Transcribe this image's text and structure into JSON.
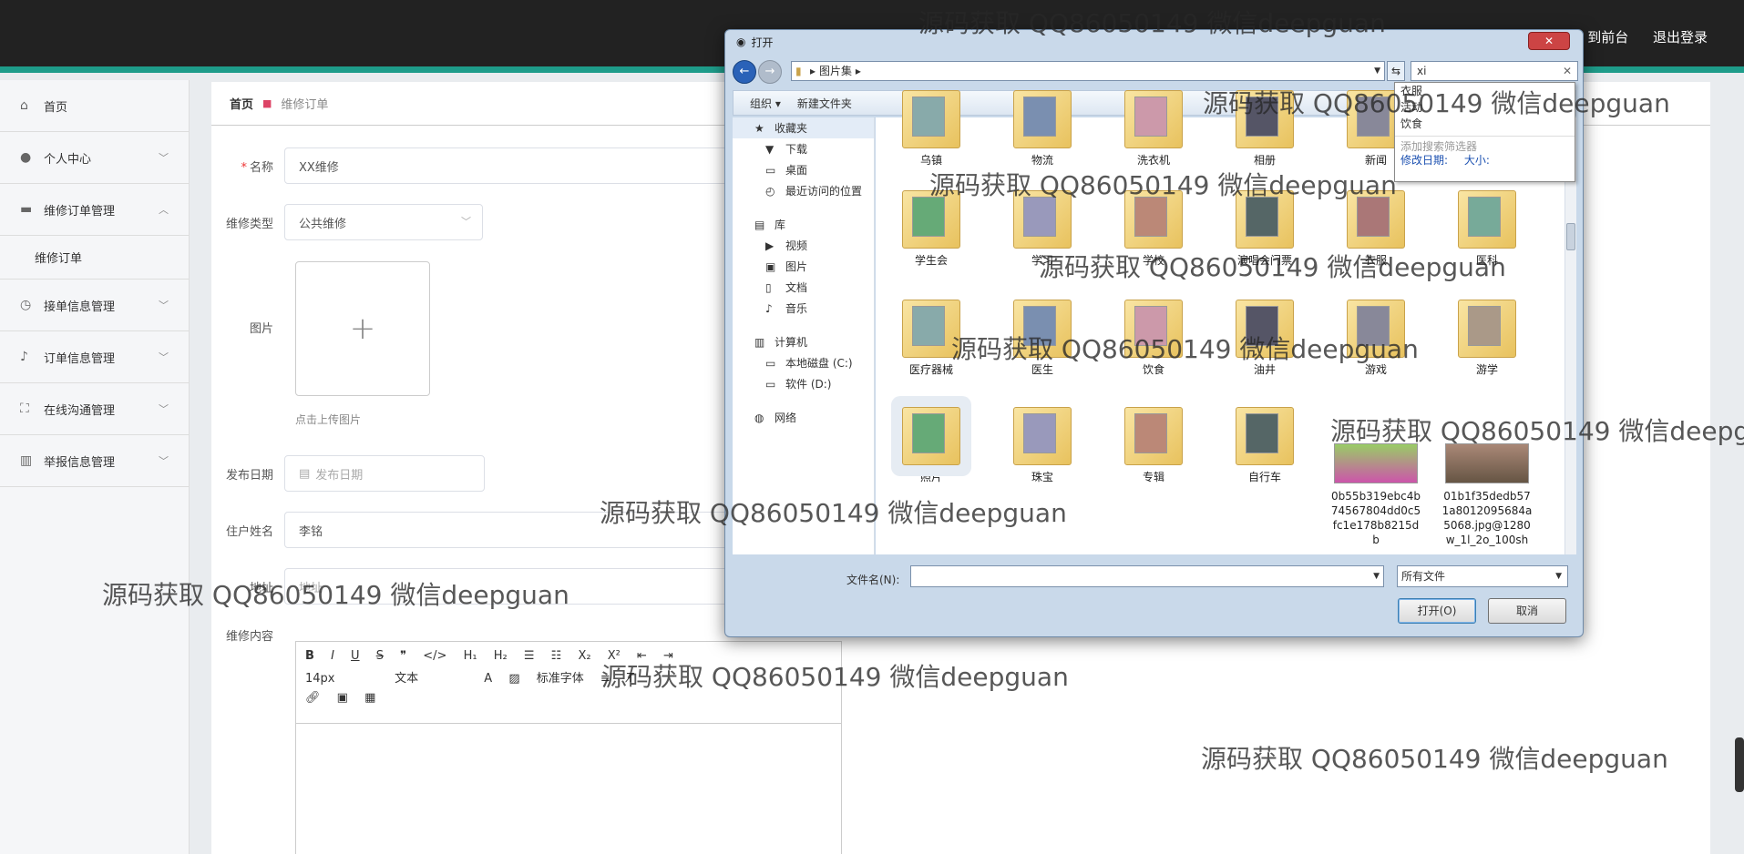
{
  "topbar": {
    "link_front": "到前台",
    "link_logout": "退出登录"
  },
  "sidebar": {
    "items": [
      {
        "label": "首页",
        "icon": "home-icon"
      },
      {
        "label": "个人中心",
        "icon": "user-icon"
      },
      {
        "label": "维修订单管理",
        "icon": "briefcase-icon"
      },
      {
        "label": "维修订单",
        "icon": ""
      },
      {
        "label": "接单信息管理",
        "icon": "clock-icon"
      },
      {
        "label": "订单信息管理",
        "icon": "mic-icon"
      },
      {
        "label": "在线沟通管理",
        "icon": "frame-icon"
      },
      {
        "label": "举报信息管理",
        "icon": "bars-icon"
      }
    ]
  },
  "breadcrumb": {
    "home": "首页",
    "current": "维修订单"
  },
  "form": {
    "name_label": "名称",
    "name_value": "XX维修",
    "type_label": "维修类型",
    "type_value": "公共维修",
    "image_label": "图片",
    "upload_hint": "点击上传图片",
    "date_label": "发布日期",
    "date_placeholder": "发布日期",
    "resident_label": "住户姓名",
    "resident_value": "李铭",
    "address_label": "地址",
    "address_value": "地址",
    "content_label": "维修内容",
    "editor_font_size": "14px",
    "editor_text": "文本",
    "editor_heading": "标准字体"
  },
  "dialog": {
    "title": "打开",
    "close": "✕",
    "path": "图片集",
    "search_value": "xi",
    "toolbar_organize": "组织 ▾",
    "toolbar_newfolder": "新建文件夹",
    "tree": [
      {
        "label": "收藏夹",
        "icon": "star-icon",
        "sub": false,
        "hl": true
      },
      {
        "label": "下载",
        "icon": "download-icon",
        "sub": true
      },
      {
        "label": "桌面",
        "icon": "desktop-icon",
        "sub": true
      },
      {
        "label": "最近访问的位置",
        "icon": "recent-icon",
        "sub": true
      },
      {
        "label": "库",
        "icon": "library-icon",
        "sub": false,
        "gap": true
      },
      {
        "label": "视频",
        "icon": "video-icon",
        "sub": true
      },
      {
        "label": "图片",
        "icon": "picture-icon",
        "sub": true
      },
      {
        "label": "文档",
        "icon": "document-icon",
        "sub": true
      },
      {
        "label": "音乐",
        "icon": "music-icon",
        "sub": true
      },
      {
        "label": "计算机",
        "icon": "computer-icon",
        "sub": false,
        "gap": true
      },
      {
        "label": "本地磁盘 (C:)",
        "icon": "disk-icon",
        "sub": true
      },
      {
        "label": "软件 (D:)",
        "icon": "disk-icon",
        "sub": true
      },
      {
        "label": "网络",
        "icon": "network-icon",
        "sub": false,
        "gap": true
      }
    ],
    "files": [
      "乌镇",
      "物流",
      "洗衣机",
      "相册",
      "新闻",
      "",
      "学生会",
      "学习",
      "学校",
      "演唱会门票",
      "衣服",
      "医科",
      "医疗器械",
      "医生",
      "饮食",
      "油井",
      "游戏",
      "游学",
      "照片",
      "珠宝",
      "专辑",
      "自行车",
      "0b55b319ebc4b74567804dd0c5fc1e178b8215db",
      "01b1f35dedb571a8012095684a5068.jpg@1280w_1l_2o_100sh"
    ],
    "filename_label": "文件名(N):",
    "filename_value": "",
    "filetype_value": "所有文件",
    "open_button": "打开(O)",
    "cancel_button": "取消"
  },
  "search_dropdown": {
    "items": [
      "衣服",
      "活动",
      "饮食"
    ],
    "hint": "添加搜索筛选器",
    "filter_date": "修改日期:",
    "filter_size": "大小:"
  },
  "watermark": "源码获取 QQ86050149 微信deepguan"
}
